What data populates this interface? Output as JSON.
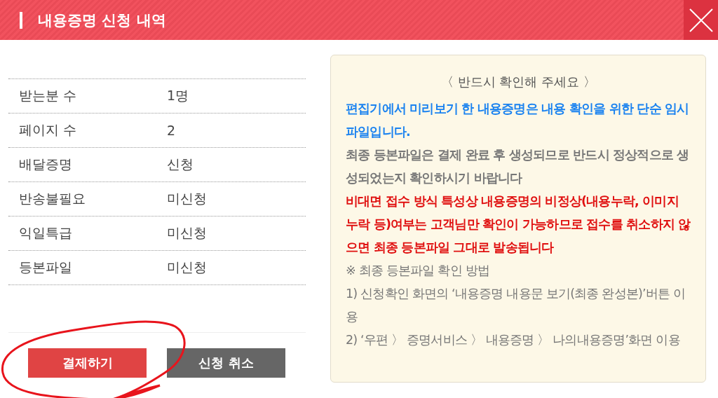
{
  "window": {
    "title": "내용증명 신청 내역"
  },
  "summary": [
    {
      "label": "받는분 수",
      "value": "1명"
    },
    {
      "label": "페이지 수",
      "value": "2"
    },
    {
      "label": "배달증명",
      "value": "신청"
    },
    {
      "label": "반송불필요",
      "value": "미신청"
    },
    {
      "label": "익일특급",
      "value": "미신청"
    },
    {
      "label": "등본파일",
      "value": "미신청"
    }
  ],
  "buttons": [
    {
      "label": "결제하기",
      "kind": "primary"
    },
    {
      "label": "신청 취소",
      "kind": "secondary"
    }
  ],
  "notice": {
    "title": "〈 반드시 확인해 주세요 〉",
    "paragraphs": [
      {
        "kind": "info",
        "text": "편집기에서 미리보기 한 내용증명은 내용 확인을 위한 단순 임시 파일입니다."
      },
      {
        "kind": "plain",
        "text": "최종 등본파일은 결제 완료 후 생성되므로 반드시 정상적으로 생성되었는지 확인하시기 바랍니다"
      },
      {
        "kind": "warning",
        "text": "비대면 접수 방식 특성상 내용증명의 비정상(내용누락, 이미지 누락 등)여부는 고객님만 확인이 가능하므로 접수를 취소하지 않으면 최종 등본파일 그대로 발송됩니다"
      },
      {
        "kind": "note",
        "text": "※ 최종 등본파일 확인 방법"
      },
      {
        "kind": "note",
        "text": "1) 신청확인 화면의 ‘내용증명 내용문 보기(최종 완성본)’버튼 이용"
      },
      {
        "kind": "note",
        "text": "2) ‘우편 〉 증명서비스 〉 내용증명 〉 나의내용증명’화면 이용"
      }
    ]
  },
  "annotation": {
    "kind": "circle"
  }
}
